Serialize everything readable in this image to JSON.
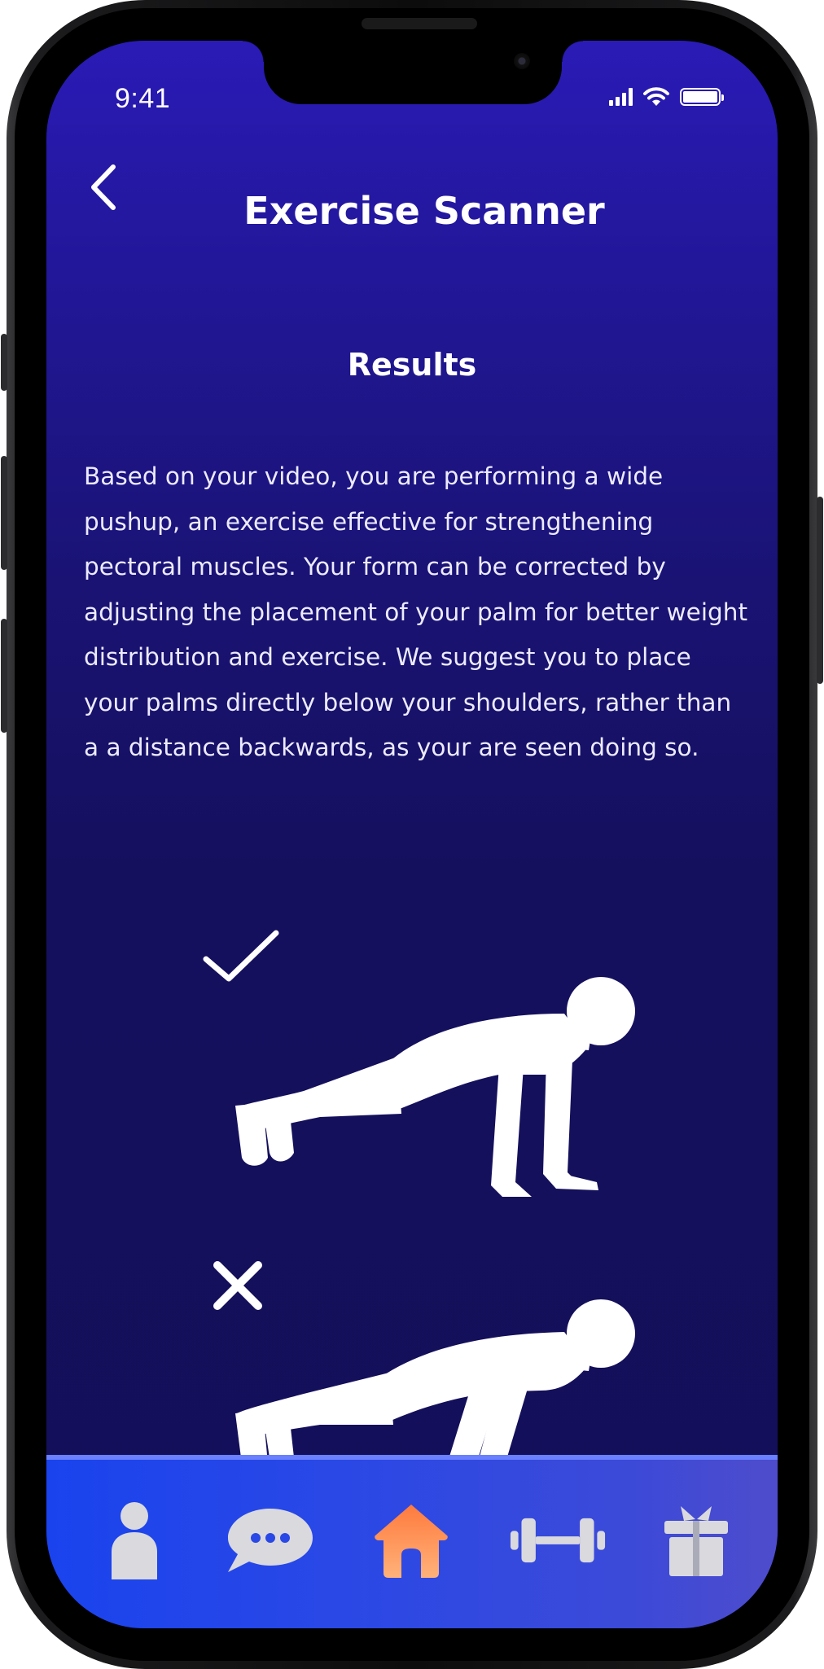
{
  "status_bar": {
    "time": "9:41"
  },
  "header": {
    "title": "Exercise Scanner"
  },
  "results": {
    "heading": "Results",
    "text": "Based on your video, you are performing a wide pushup, an exercise effective for strengthening pectoral muscles. Your form can be corrected by adjusting the placement of your palm for better weight distribution and exercise. We suggest you to place your palms directly below your shoulders, rather than a a distance backwards, as your are seen doing so."
  },
  "icons": {
    "back": "chevron-left-icon",
    "correct": "checkmark-icon",
    "incorrect": "cross-icon",
    "nav": [
      "person-icon",
      "chat-bubble-icon",
      "home-icon",
      "dumbbell-icon",
      "gift-icon"
    ]
  },
  "colors": {
    "background_top": "#2a1bb6",
    "background_bottom": "#130f58",
    "nav_bar": "#2a48e6",
    "nav_active": "#ff8c5a",
    "nav_inactive": "#d9d9de"
  },
  "bottom_nav": {
    "active_index": 2
  }
}
